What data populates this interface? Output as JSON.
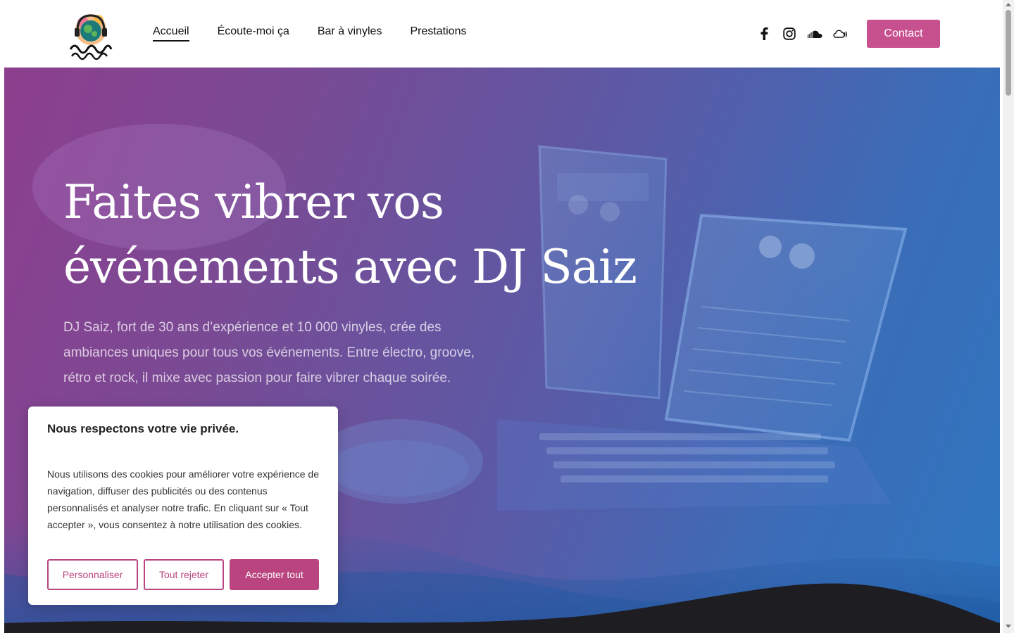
{
  "header": {
    "logo_alt": "DJ Saiz",
    "nav": [
      {
        "label": "Accueil",
        "active": true
      },
      {
        "label": "Écoute-moi ça",
        "active": false
      },
      {
        "label": "Bar à vinyles",
        "active": false
      },
      {
        "label": "Prestations",
        "active": false
      }
    ],
    "socials": [
      "facebook-icon",
      "instagram-icon",
      "soundcloud-icon",
      "mixcloud-icon"
    ],
    "contact_label": "Contact"
  },
  "hero": {
    "title_line1": "Faites vibrer vos",
    "title_line2": "événements avec DJ Saiz",
    "text": "DJ Saiz, fort de 30 ans d’expérience et 10 000 vinyles, crée des ambiances uniques pour tous vos événements. Entre électro, groove, rétro et rock, il mixe avec passion pour faire vibrer chaque soirée."
  },
  "cookie": {
    "title": "Nous respectons votre vie privée.",
    "text": "Nous utilisons des cookies pour améliorer votre expérience de navigation, diffuser des publicités ou des contenus personnalisés et analyser notre trafic. En cliquant sur « Tout accepter », vous consentez à notre utilisation des cookies.",
    "customize_label": "Personnaliser",
    "reject_label": "Tout rejeter",
    "accept_label": "Accepter tout"
  },
  "colors": {
    "accent": "#c7508f",
    "accent_dark": "#b9447f",
    "hero_start": "#8c3f8e",
    "hero_end": "#2f76c0",
    "footer_dark": "#1e1d22"
  }
}
